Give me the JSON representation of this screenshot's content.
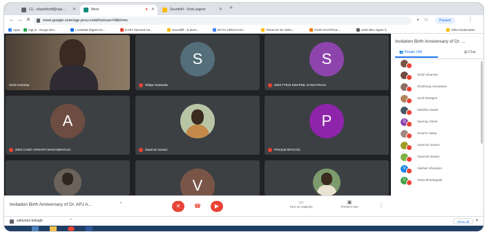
{
  "tabs": [
    {
      "title": "(1) - sdasddrsdf@raje...",
      "color": "#5f6368"
    },
    {
      "title": "Meet",
      "color": "#00897b"
    },
    {
      "title": "Sourdirifi - Vrisk yagoor",
      "color": "#fbbc04"
    }
  ],
  "new_tab_icon": "+",
  "address": {
    "url": "meet.google.com/zqp-yevu-vvnb/hs/ruoe=0&hl=en"
  },
  "profile": {
    "label": "Paused"
  },
  "bookmarks": [
    {
      "label": "Apps",
      "color": "#4285f4"
    },
    {
      "label": "mgr.in - Durga Dev...",
      "color": "#34a853"
    },
    {
      "label": "Lootstaat Digeet Un...",
      "color": "#1a73e8"
    },
    {
      "label": "E-NIT Samved Un...",
      "color": "#ea4335"
    },
    {
      "label": "Soundlift - & deen...",
      "color": "#fbbc04"
    },
    {
      "label": "DCTH URNAH H2...",
      "color": "#4285f4"
    },
    {
      "label": "Tinnervie his Selec...",
      "color": "#fbbc04"
    },
    {
      "label": "ITHRI 9ASTRIUL...",
      "color": "#f57c00"
    },
    {
      "label": "sarfe Bite Japan li...",
      "color": "#5f6368"
    }
  ],
  "other_bookmarks": "Other bookmarks",
  "rec_label": "REC",
  "tiles": [
    {
      "name": "Girish Kokulap",
      "type": "video",
      "bg": "#6b5a47"
    },
    {
      "name": "Shilpa Gawande",
      "initial": "S",
      "color": "#546e7a"
    },
    {
      "name": "2003 FT815 SWAPNIL SANJAYRAUL",
      "initial": "S",
      "color": "#8e44ad"
    },
    {
      "name": "2003 CH387 ARSHITA MADANMAVALE",
      "initial": "A",
      "color": "#6d4c41"
    },
    {
      "name": "Swarnini Zavare",
      "type": "photo"
    },
    {
      "name": "Principal MITACSC",
      "initial": "P",
      "color": "#8e24aa"
    },
    {
      "name": "",
      "type": "video"
    },
    {
      "name": "",
      "initial": "V",
      "color": "#795548"
    },
    {
      "name": "",
      "type": "photo"
    }
  ],
  "bottom_bar": {
    "meeting_title": "Invitation Birth Anniversary of Dr. APJ A...",
    "captions_label": "Turn on captions",
    "present_label": "Present now"
  },
  "panel": {
    "title": "Invitation Birth Anniversary of Dr. ...",
    "people_tab": "People (44)",
    "chat_tab": "Chat",
    "participants": [
      {
        "name": "",
        "initial": "",
        "color": "#795548"
      },
      {
        "name": "Girish Dhamne",
        "initial": "",
        "color": "#6d4c41"
      },
      {
        "name": "Shubhang Sonawane",
        "initial": "",
        "color": "#8d6e63"
      },
      {
        "name": "Sunil Waragne",
        "initial": "",
        "color": "#b2845b"
      },
      {
        "name": "Sakshia Awade",
        "initial": "",
        "color": "#455a64"
      },
      {
        "name": "Sanmay Shete",
        "initial": "S",
        "color": "#8e44ad"
      },
      {
        "name": "Smarmi Satay",
        "initial": "",
        "color": "#a1887f"
      },
      {
        "name": "Swarnini Zavare",
        "initial": "",
        "color": "#9e9d24"
      },
      {
        "name": "Swarnini Zavare",
        "initial": "",
        "color": "#7cb342"
      },
      {
        "name": "Vaishali Khandare",
        "initial": "V",
        "color": "#1e88e5"
      },
      {
        "name": "Vinija Bhardagade",
        "initial": "V",
        "color": "#43a047"
      }
    ]
  },
  "download": {
    "file": "saltunani dabagh",
    "show_all": "Show all"
  }
}
